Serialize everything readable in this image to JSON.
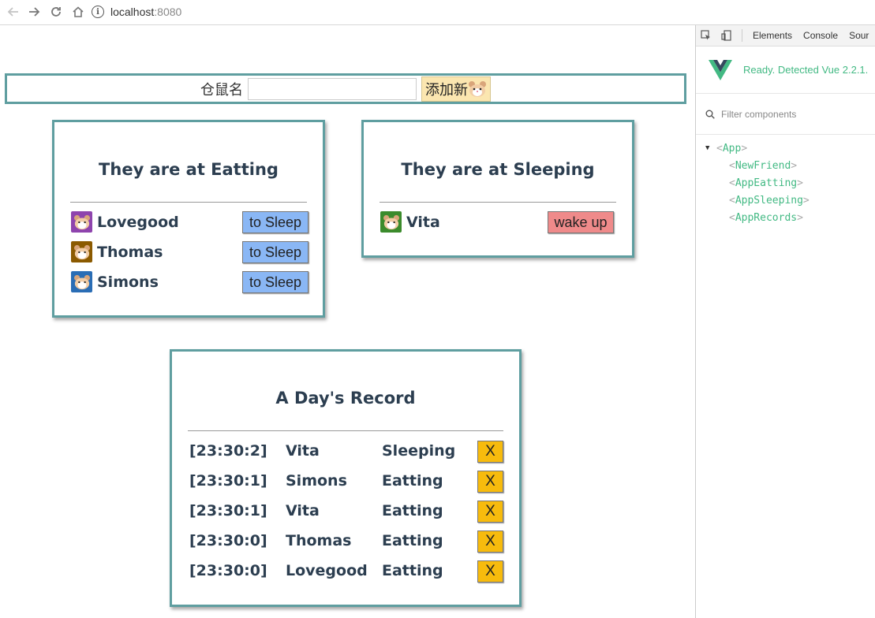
{
  "browser": {
    "url_host": "localhost",
    "url_port": ":8080",
    "info_icon": "i"
  },
  "new_friend": {
    "label": "仓鼠名",
    "input_value": "",
    "add_button_label": "添加新"
  },
  "eating_panel": {
    "title": "They are at Eatting",
    "items": [
      {
        "name": "Lovegood",
        "action": "to Sleep",
        "avatar_color": "#8e44ad"
      },
      {
        "name": "Thomas",
        "action": "to Sleep",
        "avatar_color": "#8b5a00"
      },
      {
        "name": "Simons",
        "action": "to Sleep",
        "avatar_color": "#2a6db5"
      }
    ]
  },
  "sleeping_panel": {
    "title": "They are at Sleeping",
    "items": [
      {
        "name": "Vita",
        "action": "wake up",
        "avatar_color": "#3b8b2c"
      }
    ]
  },
  "records_panel": {
    "title": "A Day's Record",
    "rows": [
      {
        "time": "[23:30:2]",
        "name": "Vita",
        "state": "Sleeping",
        "remove": "X"
      },
      {
        "time": "[23:30:1]",
        "name": "Simons",
        "state": "Eatting",
        "remove": "X"
      },
      {
        "time": "[23:30:1]",
        "name": "Vita",
        "state": "Eatting",
        "remove": "X"
      },
      {
        "time": "[23:30:0]",
        "name": "Thomas",
        "state": "Eatting",
        "remove": "X"
      },
      {
        "time": "[23:30:0]",
        "name": "Lovegood",
        "state": "Eatting",
        "remove": "X"
      }
    ]
  },
  "devtools": {
    "tabs": [
      "Elements",
      "Console",
      "Sour"
    ],
    "vue_status": "Ready. Detected Vue 2.2.1.",
    "filter_placeholder": "Filter components",
    "tree": {
      "root": "App",
      "children": [
        "NewFriend",
        "AppEatting",
        "AppSleeping",
        "AppRecords"
      ]
    }
  },
  "colors": {
    "panel_border": "#5f9ea0",
    "sleep_button": "#8ab7f5",
    "wake_button": "#ef8a8a",
    "remove_button": "#f7bb0d",
    "add_button": "#fbe6b0",
    "vue_green": "#42b983"
  }
}
